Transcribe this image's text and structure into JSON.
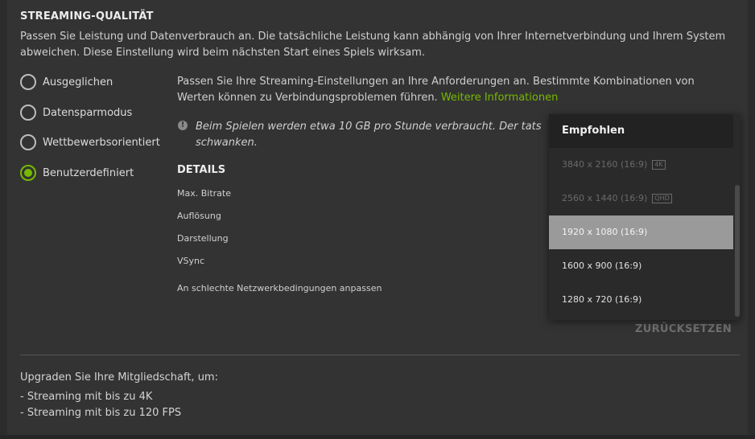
{
  "section": {
    "title": "STREAMING-QUALITÄT",
    "description": "Passen Sie Leistung und Datenverbrauch an. Die tatsächliche Leistung kann abhängig von Ihrer Internetverbindung und Ihrem System abweichen. Diese Einstellung wird beim nächsten Start eines Spiels wirksam."
  },
  "presets": [
    {
      "label": "Ausgeglichen",
      "selected": false
    },
    {
      "label": "Datensparmodus",
      "selected": false
    },
    {
      "label": "Wettbewerbsorientiert",
      "selected": false
    },
    {
      "label": "Benutzerdefiniert",
      "selected": true
    }
  ],
  "info": {
    "text": "Passen Sie Ihre Streaming-Einstellungen an Ihre Anforderungen an. Bestimmte Kombinationen von Werten können zu Verbindungsproblemen führen.",
    "link": "Weitere Informationen"
  },
  "note": {
    "icon": "info-icon",
    "text": "Beim Spielen werden etwa 10 GB pro Stunde verbraucht. Der tats schwanken."
  },
  "details": {
    "heading": "DETAILS",
    "rows": [
      "Max. Bitrate",
      "Auflösung",
      "Darstellung",
      "VSync",
      "An schlechte Netzwerkbedingungen anpassen"
    ]
  },
  "dropdown": {
    "header": "Empfohlen",
    "options": [
      {
        "label": "3840 x 2160 (16:9)",
        "badge": "4K",
        "state": "disabled"
      },
      {
        "label": "2560 x 1440 (16:9)",
        "badge": "QHD",
        "state": "disabled"
      },
      {
        "label": "1920 x 1080 (16:9)",
        "badge": "",
        "state": "selected"
      },
      {
        "label": "1600 x 900 (16:9)",
        "badge": "",
        "state": "normal"
      },
      {
        "label": "1280 x 720 (16:9)",
        "badge": "",
        "state": "normal"
      }
    ]
  },
  "reset_label": "ZURÜCKSETZEN",
  "upgrade": {
    "intro": "Upgraden Sie Ihre Mitgliedschaft, um:",
    "benefits": [
      "- Streaming mit bis zu 4K",
      "- Streaming mit bis zu 120 FPS"
    ]
  },
  "colors": {
    "accent": "#76b900",
    "background": "#333333",
    "dropdown_selected": "#9a9a9a"
  }
}
